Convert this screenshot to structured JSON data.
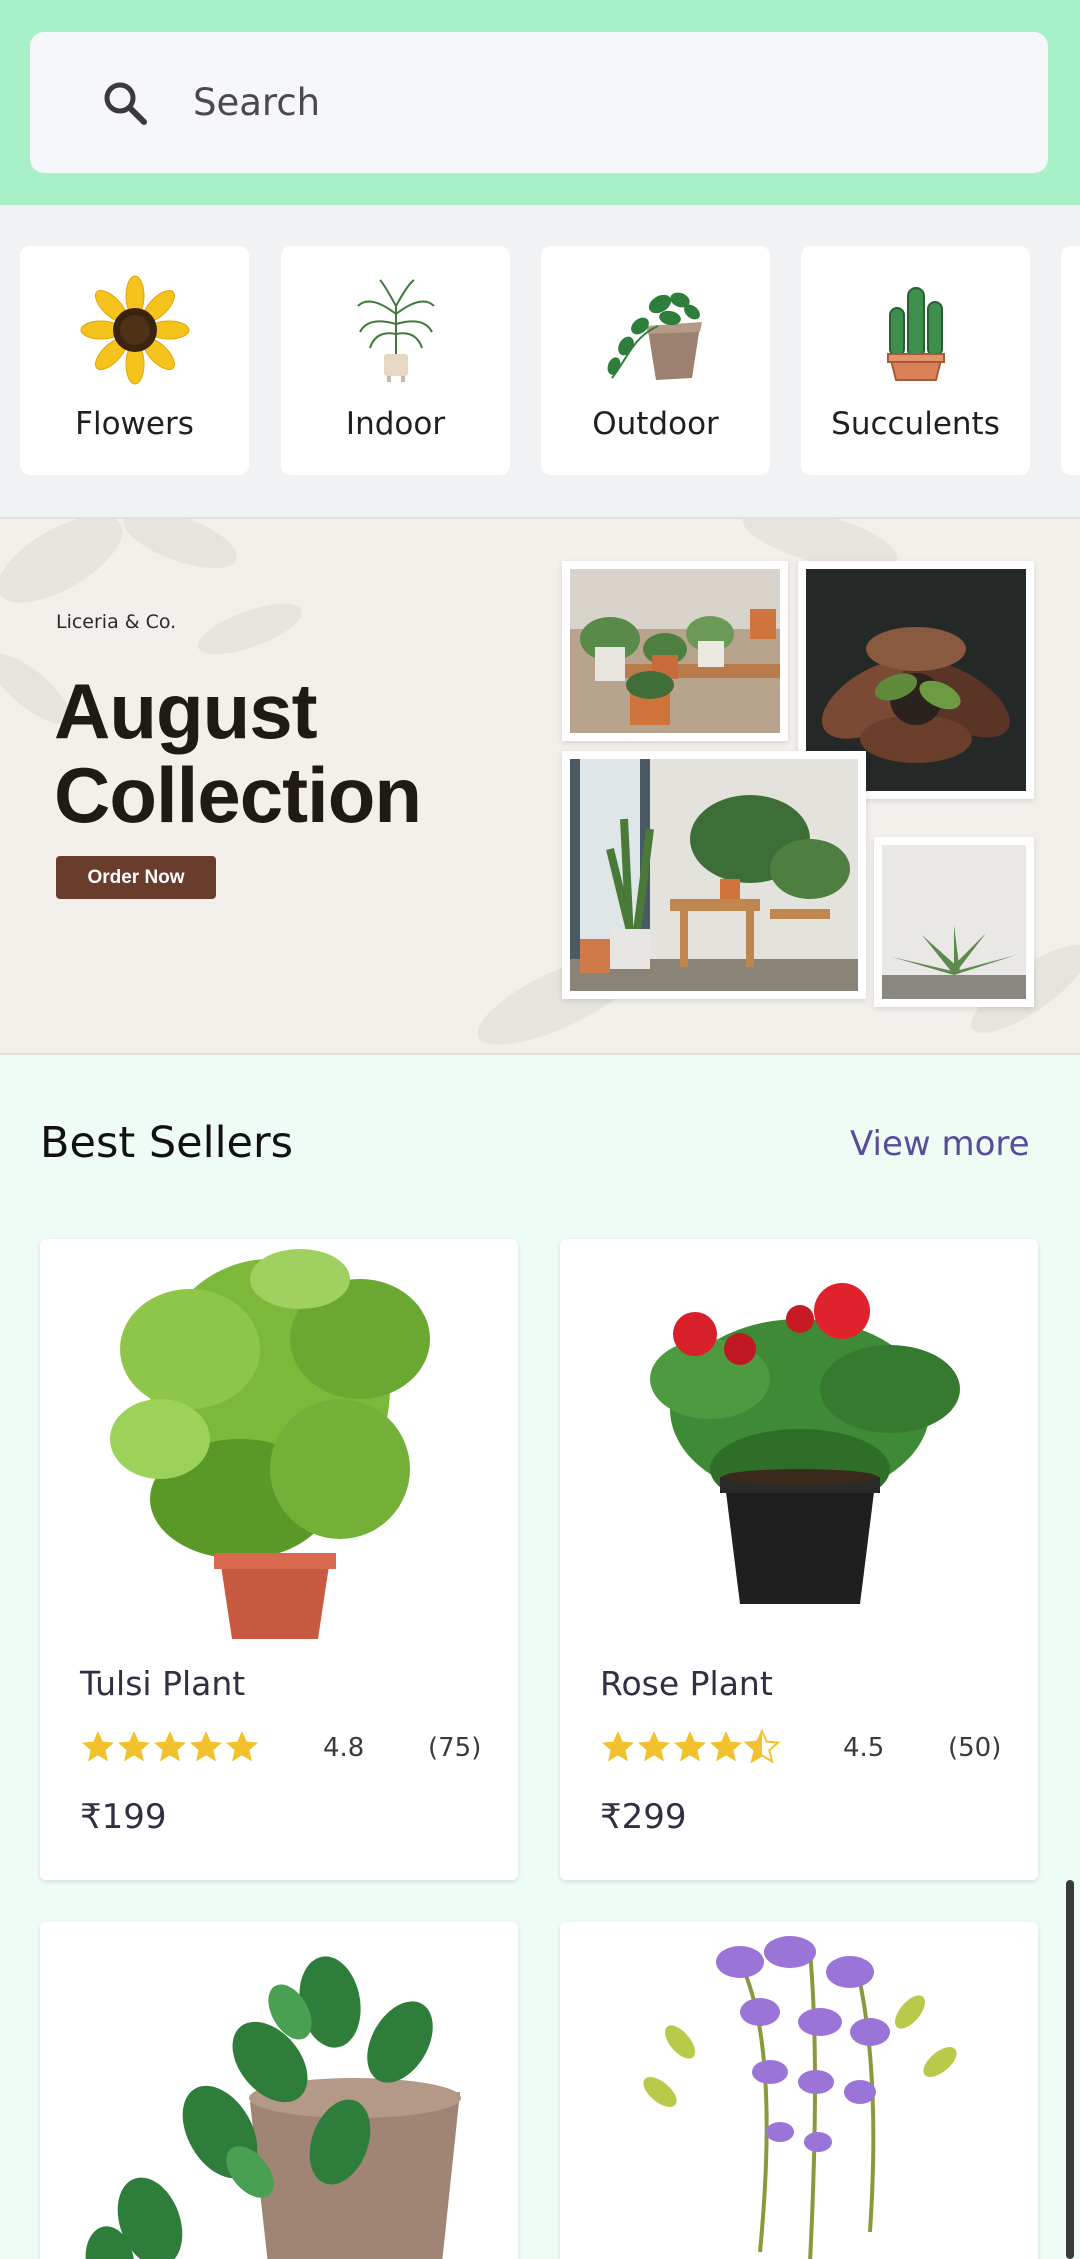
{
  "search": {
    "placeholder": "Search",
    "icon": "search-icon"
  },
  "categories": [
    {
      "label": "Flowers",
      "icon": "sunflower-icon"
    },
    {
      "label": "Indoor",
      "icon": "palm-plant-icon"
    },
    {
      "label": "Outdoor",
      "icon": "potted-vine-icon"
    },
    {
      "label": "Succulents",
      "icon": "cactus-icon"
    }
  ],
  "banner": {
    "brand": "Liceria & Co.",
    "title_line1": "August",
    "title_line2": "Collection",
    "button": "Order Now"
  },
  "best_sellers": {
    "title": "Best Sellers",
    "view_more": "View more",
    "products": [
      {
        "name": "Tulsi Plant",
        "rating": "4.8",
        "stars": 4.8,
        "count": "(75)",
        "price": "₹199"
      },
      {
        "name": "Rose Plant",
        "rating": "4.5",
        "stars": 4.5,
        "count": "(50)",
        "price": "₹299"
      },
      {
        "name": "",
        "image": "potted-vine-illustration"
      },
      {
        "name": "",
        "image": "wisteria-illustration"
      }
    ]
  },
  "colors": {
    "header": "#a8f0c8",
    "accent": "#5a4c9c",
    "star": "#f2c12e",
    "button": "#6a3c2c"
  }
}
